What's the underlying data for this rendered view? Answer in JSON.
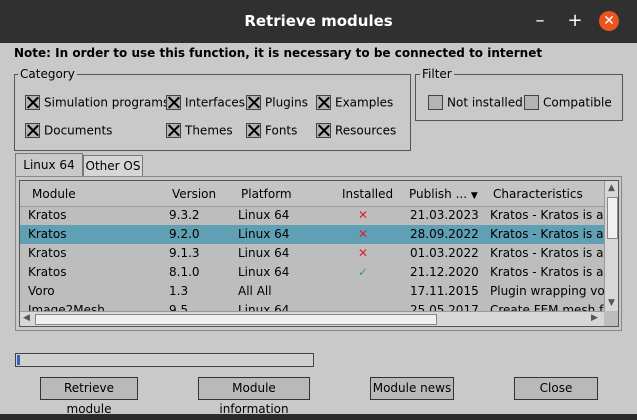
{
  "window": {
    "title": "Retrieve modules"
  },
  "note": "Note: In order to use this function, it is necessary to be connected to internet",
  "category": {
    "label": "Category",
    "items": [
      {
        "label": "Simulation programs",
        "checked": true
      },
      {
        "label": "Interfaces",
        "checked": true
      },
      {
        "label": "Plugins",
        "checked": true
      },
      {
        "label": "Examples",
        "checked": true
      },
      {
        "label": "Documents",
        "checked": true
      },
      {
        "label": "Themes",
        "checked": true
      },
      {
        "label": "Fonts",
        "checked": true
      },
      {
        "label": "Resources",
        "checked": true
      }
    ]
  },
  "filter": {
    "label": "Filter",
    "items": [
      {
        "label": "Not installed",
        "checked": false
      },
      {
        "label": "Compatible",
        "checked": false
      }
    ]
  },
  "tabs": [
    "Linux 64",
    "Other OS"
  ],
  "table": {
    "columns": [
      "Module",
      "Version",
      "Platform",
      "Installed",
      "Publish ...",
      "Characteristics"
    ],
    "rows": [
      {
        "module": "Kratos",
        "version": "9.3.2",
        "platform": "Linux 64",
        "installed": "✕",
        "publish": "21.03.2023",
        "characteristics": "Kratos - Kratos is a fra"
      },
      {
        "module": "Kratos",
        "version": "9.2.0",
        "platform": "Linux 64",
        "installed": "✕",
        "publish": "28.09.2022",
        "characteristics": "Kratos - Kratos is a fra"
      },
      {
        "module": "Kratos",
        "version": "9.1.3",
        "platform": "Linux 64",
        "installed": "✕",
        "publish": "01.03.2022",
        "characteristics": "Kratos - Kratos is a fra"
      },
      {
        "module": "Kratos",
        "version": "8.1.0",
        "platform": "Linux 64",
        "installed": "✓",
        "publish": "21.12.2020",
        "characteristics": "Kratos - Kratos is a fra"
      },
      {
        "module": "Voro",
        "version": "1.3",
        "platform": "All All",
        "installed": "",
        "publish": "17.11.2015",
        "characteristics": "Plugin wrapping voro"
      },
      {
        "module": "Image2Mesh",
        "version": "9.5",
        "platform": "Linux 64",
        "installed": "",
        "publish": "25.05.2017",
        "characteristics": "Create FEM mesh fro"
      }
    ]
  },
  "progress": {
    "value": 0.01
  },
  "buttons": {
    "retrieve": "Retrieve module",
    "info": "Module information",
    "news": "Module news",
    "close": "Close"
  },
  "colors": {
    "selected_row": "#5fa0b4",
    "not_installed": "#d8222a",
    "installed": "#3a8fb0",
    "close_button": "#e95420"
  }
}
